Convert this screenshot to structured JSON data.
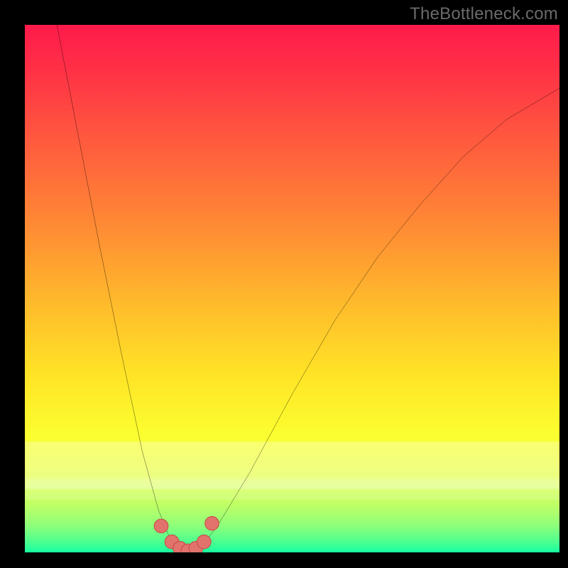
{
  "watermark": "TheBottleneck.com",
  "colors": {
    "frame": "#000000",
    "curve": "#000000",
    "marker_fill": "#e2726c",
    "marker_stroke": "#c94f49"
  },
  "chart_data": {
    "type": "line",
    "title": "",
    "xlabel": "",
    "ylabel": "",
    "xlim": [
      0,
      100
    ],
    "ylim": [
      0,
      100
    ],
    "note": "No numeric axis ticks or labels are rendered in the image; values below are estimated normalized positions (0–100) read from the pixel layout.",
    "series": [
      {
        "name": "bottleneck-curve",
        "x": [
          6,
          10,
          14,
          18,
          22,
          25,
          27,
          29,
          30.5,
          33,
          36,
          42,
          50,
          58,
          66,
          74,
          82,
          90,
          100
        ],
        "y": [
          100,
          79,
          58,
          38,
          19,
          8,
          3,
          1,
          0,
          1,
          5,
          15,
          30,
          44,
          56,
          66,
          75,
          82,
          88
        ]
      }
    ],
    "markers": {
      "name": "highlighted-points",
      "x": [
        25.5,
        27.5,
        29.0,
        30.5,
        32.0,
        33.5,
        35.0
      ],
      "y": [
        5.0,
        2.0,
        0.8,
        0.3,
        0.8,
        2.0,
        5.5
      ]
    },
    "background_gradient": {
      "orientation": "vertical",
      "stops": [
        {
          "pos": 0.0,
          "color": "#ff1a4b"
        },
        {
          "pos": 0.4,
          "color": "#ff8a34"
        },
        {
          "pos": 0.7,
          "color": "#ffe326"
        },
        {
          "pos": 0.9,
          "color": "#bfff66"
        },
        {
          "pos": 1.0,
          "color": "#17ffa0"
        }
      ]
    }
  }
}
